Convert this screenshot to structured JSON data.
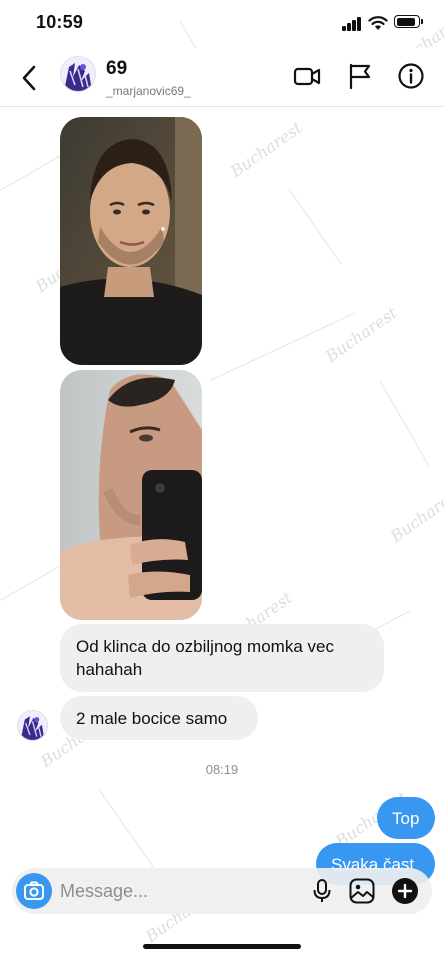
{
  "status_bar": {
    "time": "10:59"
  },
  "header": {
    "title": "69",
    "username": "_marjanovic69_",
    "back_icon": "chevron-left-icon",
    "video_icon": "video-camera-icon",
    "flag_icon": "flag-icon",
    "info_icon": "info-icon"
  },
  "messages": [
    {
      "type": "photo",
      "description_icon": "photo-message"
    },
    {
      "type": "photo",
      "description_icon": "photo-message"
    },
    {
      "type": "text",
      "direction": "incoming",
      "text": "Od klinca do ozbiljnog momka vec hahahah"
    },
    {
      "type": "text",
      "direction": "incoming",
      "text": "2 male bocice samo"
    },
    {
      "type": "timestamp",
      "text": "08:19"
    },
    {
      "type": "text",
      "direction": "outgoing",
      "text": "Top"
    },
    {
      "type": "text",
      "direction": "outgoing",
      "text": "Svaka čast"
    }
  ],
  "composer": {
    "placeholder": "Message...",
    "camera_icon": "camera-icon",
    "mic_icon": "microphone-icon",
    "gallery_icon": "image-icon",
    "plus_icon": "plus-circle-icon"
  },
  "colors": {
    "accent": "#3897f0",
    "incoming_bubble": "#efefef",
    "muted_text": "#8e8e8e"
  }
}
